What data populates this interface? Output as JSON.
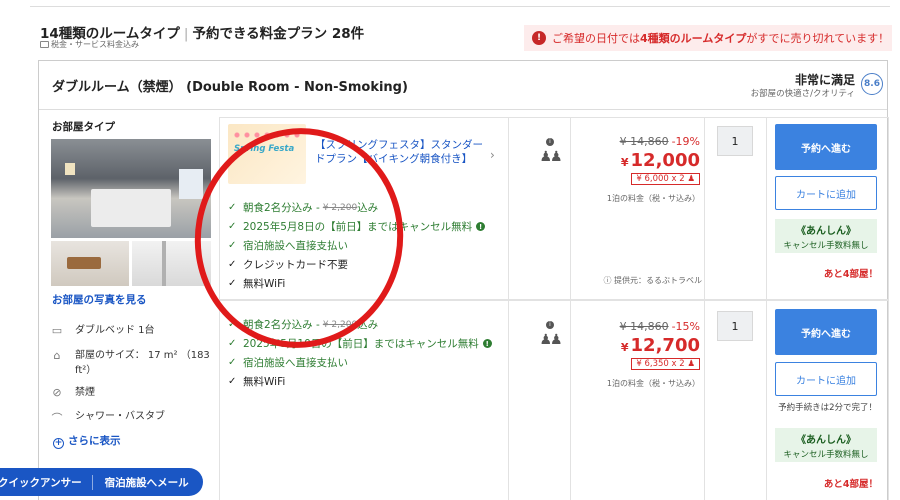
{
  "header": {
    "title_part1": "14種類のルームタイプ",
    "title_sep": "|",
    "title_part2": "予約できる料金プラン 28件",
    "subtitle": "税金・サービス料金込み",
    "soldout_prefix": "ご希望の日付では",
    "soldout_highlight": "4種類のルームタイプ",
    "soldout_suffix": "がすでに売り切れています！",
    "soldout_dot": "!"
  },
  "room": {
    "title": "ダブルルーム（禁煙） (Double Room - Non-Smoking)",
    "rating_label": "非常に満足",
    "rating_sub": "お部屋の快適さ/クオリティ",
    "rating_score": "8.6",
    "room_type_label": "お部屋タイプ",
    "see_photos": "お部屋の写真を見る",
    "features": [
      {
        "icon": "bed-icon",
        "glyph": "▭",
        "text": "ダブルベッド 1台"
      },
      {
        "icon": "room-size-icon",
        "glyph": "⌂",
        "text": "部屋のサイズ： 17 m² （183\nft²）"
      },
      {
        "icon": "no-smoking-icon",
        "glyph": "⊘",
        "text": "禁煙"
      },
      {
        "icon": "shower-icon",
        "glyph": "⌒",
        "text": "シャワー・バスタブ"
      }
    ],
    "show_more": "さらに表示"
  },
  "plans": [
    {
      "banner_text": "Spring Festa",
      "name": "【スプリングフェスタ】スタンダードプラン【バイキング朝食付き】",
      "inclusions": [
        {
          "text": "朝食2名分込み - ",
          "strike": "¥ 2,200",
          "after": " 込み",
          "color": "green"
        },
        {
          "text": "2025年5月8日の【前日】まではキャンセル無料",
          "info": "!",
          "color": "green"
        },
        {
          "text": "宿泊施設へ直接支払い",
          "color": "green"
        },
        {
          "text": "クレジットカード不要",
          "color": "black"
        },
        {
          "text": "無料WiFi",
          "color": "black"
        }
      ],
      "original_price": "¥ 14,860",
      "discount": "-19%",
      "price_yen": "¥",
      "price": "12,000",
      "per_person": "¥ 6,000 x 2 ♟",
      "price_note": "1泊の料金（税・サ込み）",
      "provider": "提供元：るるぶトラベル",
      "quantity": "1",
      "reserve_label": "予約へ進む",
      "cart_label": "カートに追加",
      "anshin_title": "《あんしん》",
      "anshin_sub": "キャンセル手数料無し",
      "rooms_left": "あと4部屋！"
    },
    {
      "inclusions": [
        {
          "text": "朝食2名分込み - ",
          "strike": "¥ 2,200",
          "after": " 込み",
          "color": "green"
        },
        {
          "text": "2025年5月10日の【前日】まではキャンセル無料",
          "info": "!",
          "color": "green"
        },
        {
          "text": "宿泊施設へ直接支払い",
          "color": "green"
        },
        {
          "text": "無料WiFi",
          "color": "black"
        }
      ],
      "original_price": "¥ 14,860",
      "discount": "-15%",
      "price_yen": "¥",
      "price": "12,700",
      "per_person": "¥ 6,350 x 2 ♟",
      "price_note": "1泊の料金（税・サ込み）",
      "quantity": "1",
      "reserve_label": "予約へ進む",
      "cart_label": "カートに追加",
      "process_note": "予約手続きは2分で完了！",
      "anshin_title": "《あんしん》",
      "anshin_sub": "キャンセル手数料無し",
      "rooms_left": "あと4部屋！"
    }
  ],
  "floatbar": {
    "item1": "クイックアンサー",
    "item2": "宿泊施設へメール"
  },
  "colors": {
    "accent": "#3b82e0",
    "alert": "#d62a2a",
    "success": "#2e7d32",
    "link": "#1a56c4"
  }
}
